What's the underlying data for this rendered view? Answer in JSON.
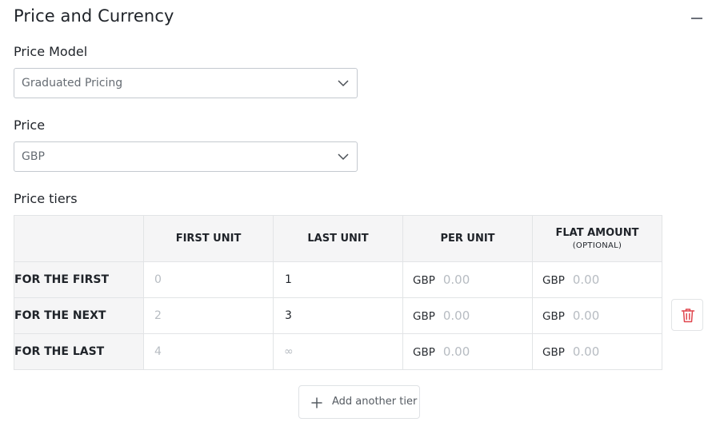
{
  "section": {
    "title": "Price and Currency"
  },
  "price_model": {
    "label": "Price Model",
    "selected": "Graduated Pricing"
  },
  "price": {
    "label": "Price",
    "selected": "GBP"
  },
  "tiers": {
    "label": "Price tiers",
    "headers": {
      "first_unit": "FIRST UNIT",
      "last_unit": "LAST UNIT",
      "per_unit": "PER UNIT",
      "flat_amount": "FLAT AMOUNT",
      "flat_amount_sub": "(OPTIONAL)"
    },
    "rows": [
      {
        "label": "FOR THE FIRST",
        "first_unit": "0",
        "last_unit": "1",
        "per_unit_currency": "GBP",
        "per_unit": "0.00",
        "flat_currency": "GBP",
        "flat_amount": "0.00"
      },
      {
        "label": "FOR THE NEXT",
        "first_unit": "2",
        "last_unit": "3",
        "per_unit_currency": "GBP",
        "per_unit": "0.00",
        "flat_currency": "GBP",
        "flat_amount": "0.00"
      },
      {
        "label": "FOR THE LAST",
        "first_unit": "4",
        "last_unit": "∞",
        "per_unit_currency": "GBP",
        "per_unit": "0.00",
        "flat_currency": "GBP",
        "flat_amount": "0.00"
      }
    ]
  },
  "add_tier": {
    "label": "Add another tier"
  },
  "icons": {
    "collapse": "minus-icon",
    "chevron": "chevron-down-icon",
    "delete": "trash-icon",
    "add": "plus-icon"
  },
  "colors": {
    "danger": "#e0464e",
    "border": "#c4c9cf",
    "header_bg": "#f5f5f6"
  }
}
